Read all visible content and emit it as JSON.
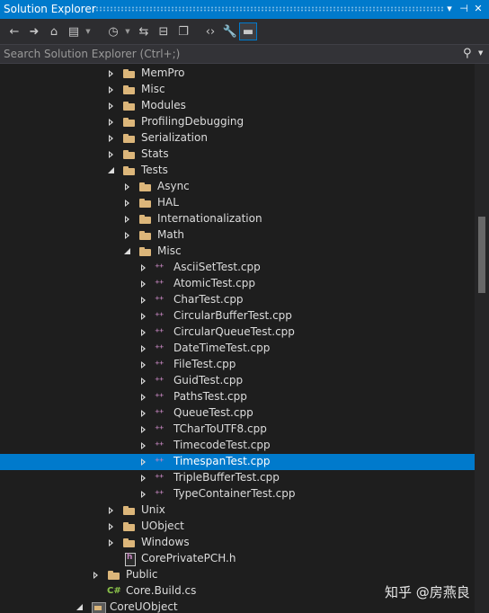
{
  "window": {
    "title": "Solution Explorer",
    "pin_icon": "pin-icon",
    "close_icon": "close-icon"
  },
  "toolbar": {
    "buttons": [
      {
        "name": "back-button",
        "icon": "arrow-left-icon",
        "glyph": "←"
      },
      {
        "name": "forward-button",
        "icon": "arrow-right-icon",
        "glyph": "➜"
      },
      {
        "name": "home-button",
        "icon": "home-icon",
        "glyph": "⌂"
      },
      {
        "name": "switch-views-button",
        "icon": "switch-views-icon",
        "glyph": "▤"
      },
      {
        "name": "pending-changes-button",
        "icon": "clock-icon",
        "glyph": "◷"
      },
      {
        "name": "sync-button",
        "icon": "sync-icon",
        "glyph": "⇆"
      },
      {
        "name": "collapse-all-button",
        "icon": "collapse-all-icon",
        "glyph": "⊟"
      },
      {
        "name": "show-all-files-button",
        "icon": "files-icon",
        "glyph": "❐"
      },
      {
        "name": "view-code-button",
        "icon": "code-icon",
        "glyph": "‹›"
      },
      {
        "name": "properties-button",
        "icon": "wrench-icon",
        "glyph": "🔧"
      },
      {
        "name": "preview-button",
        "icon": "preview-icon",
        "glyph": "▬"
      }
    ]
  },
  "search": {
    "placeholder": "Search Solution Explorer (Ctrl+;)",
    "value": ""
  },
  "tree": {
    "items": [
      {
        "label": "MemPro",
        "level": 3,
        "type": "folder",
        "state": "collapsed"
      },
      {
        "label": "Misc",
        "level": 3,
        "type": "folder",
        "state": "collapsed"
      },
      {
        "label": "Modules",
        "level": 3,
        "type": "folder",
        "state": "collapsed"
      },
      {
        "label": "ProfilingDebugging",
        "level": 3,
        "type": "folder",
        "state": "collapsed"
      },
      {
        "label": "Serialization",
        "level": 3,
        "type": "folder",
        "state": "collapsed"
      },
      {
        "label": "Stats",
        "level": 3,
        "type": "folder",
        "state": "collapsed"
      },
      {
        "label": "Tests",
        "level": 3,
        "type": "folder",
        "state": "expanded"
      },
      {
        "label": "Async",
        "level": 4,
        "type": "folder",
        "state": "collapsed"
      },
      {
        "label": "HAL",
        "level": 4,
        "type": "folder",
        "state": "collapsed"
      },
      {
        "label": "Internationalization",
        "level": 4,
        "type": "folder",
        "state": "collapsed"
      },
      {
        "label": "Math",
        "level": 4,
        "type": "folder",
        "state": "collapsed"
      },
      {
        "label": "Misc",
        "level": 4,
        "type": "folder",
        "state": "expanded"
      },
      {
        "label": "AsciiSetTest.cpp",
        "level": 5,
        "type": "cpp",
        "state": "collapsed"
      },
      {
        "label": "AtomicTest.cpp",
        "level": 5,
        "type": "cpp",
        "state": "collapsed"
      },
      {
        "label": "CharTest.cpp",
        "level": 5,
        "type": "cpp",
        "state": "collapsed"
      },
      {
        "label": "CircularBufferTest.cpp",
        "level": 5,
        "type": "cpp",
        "state": "collapsed"
      },
      {
        "label": "CircularQueueTest.cpp",
        "level": 5,
        "type": "cpp",
        "state": "collapsed"
      },
      {
        "label": "DateTimeTest.cpp",
        "level": 5,
        "type": "cpp",
        "state": "collapsed"
      },
      {
        "label": "FileTest.cpp",
        "level": 5,
        "type": "cpp",
        "state": "collapsed"
      },
      {
        "label": "GuidTest.cpp",
        "level": 5,
        "type": "cpp",
        "state": "collapsed"
      },
      {
        "label": "PathsTest.cpp",
        "level": 5,
        "type": "cpp",
        "state": "collapsed"
      },
      {
        "label": "QueueTest.cpp",
        "level": 5,
        "type": "cpp",
        "state": "collapsed"
      },
      {
        "label": "TCharToUTF8.cpp",
        "level": 5,
        "type": "cpp",
        "state": "collapsed"
      },
      {
        "label": "TimecodeTest.cpp",
        "level": 5,
        "type": "cpp",
        "state": "collapsed"
      },
      {
        "label": "TimespanTest.cpp",
        "level": 5,
        "type": "cpp",
        "state": "collapsed",
        "selected": true
      },
      {
        "label": "TripleBufferTest.cpp",
        "level": 5,
        "type": "cpp",
        "state": "collapsed"
      },
      {
        "label": "TypeContainerTest.cpp",
        "level": 5,
        "type": "cpp",
        "state": "collapsed"
      },
      {
        "label": "Unix",
        "level": 3,
        "type": "folder",
        "state": "collapsed"
      },
      {
        "label": "UObject",
        "level": 3,
        "type": "folder",
        "state": "collapsed"
      },
      {
        "label": "Windows",
        "level": 3,
        "type": "folder",
        "state": "collapsed"
      },
      {
        "label": "CorePrivatePCH.h",
        "level": 3,
        "type": "header",
        "state": "none"
      },
      {
        "label": "Public",
        "level": 2,
        "type": "folder",
        "state": "collapsed"
      },
      {
        "label": "Core.Build.cs",
        "level": 2,
        "type": "cs",
        "state": "none"
      },
      {
        "label": "CoreUObject",
        "level": 1,
        "type": "project",
        "state": "expanded"
      }
    ]
  },
  "colors": {
    "selection": "#007acc",
    "folder": "#dcb67a",
    "cpp": "#c586c0",
    "cs": "#8bc34a"
  },
  "watermark": "知乎 @房燕良"
}
